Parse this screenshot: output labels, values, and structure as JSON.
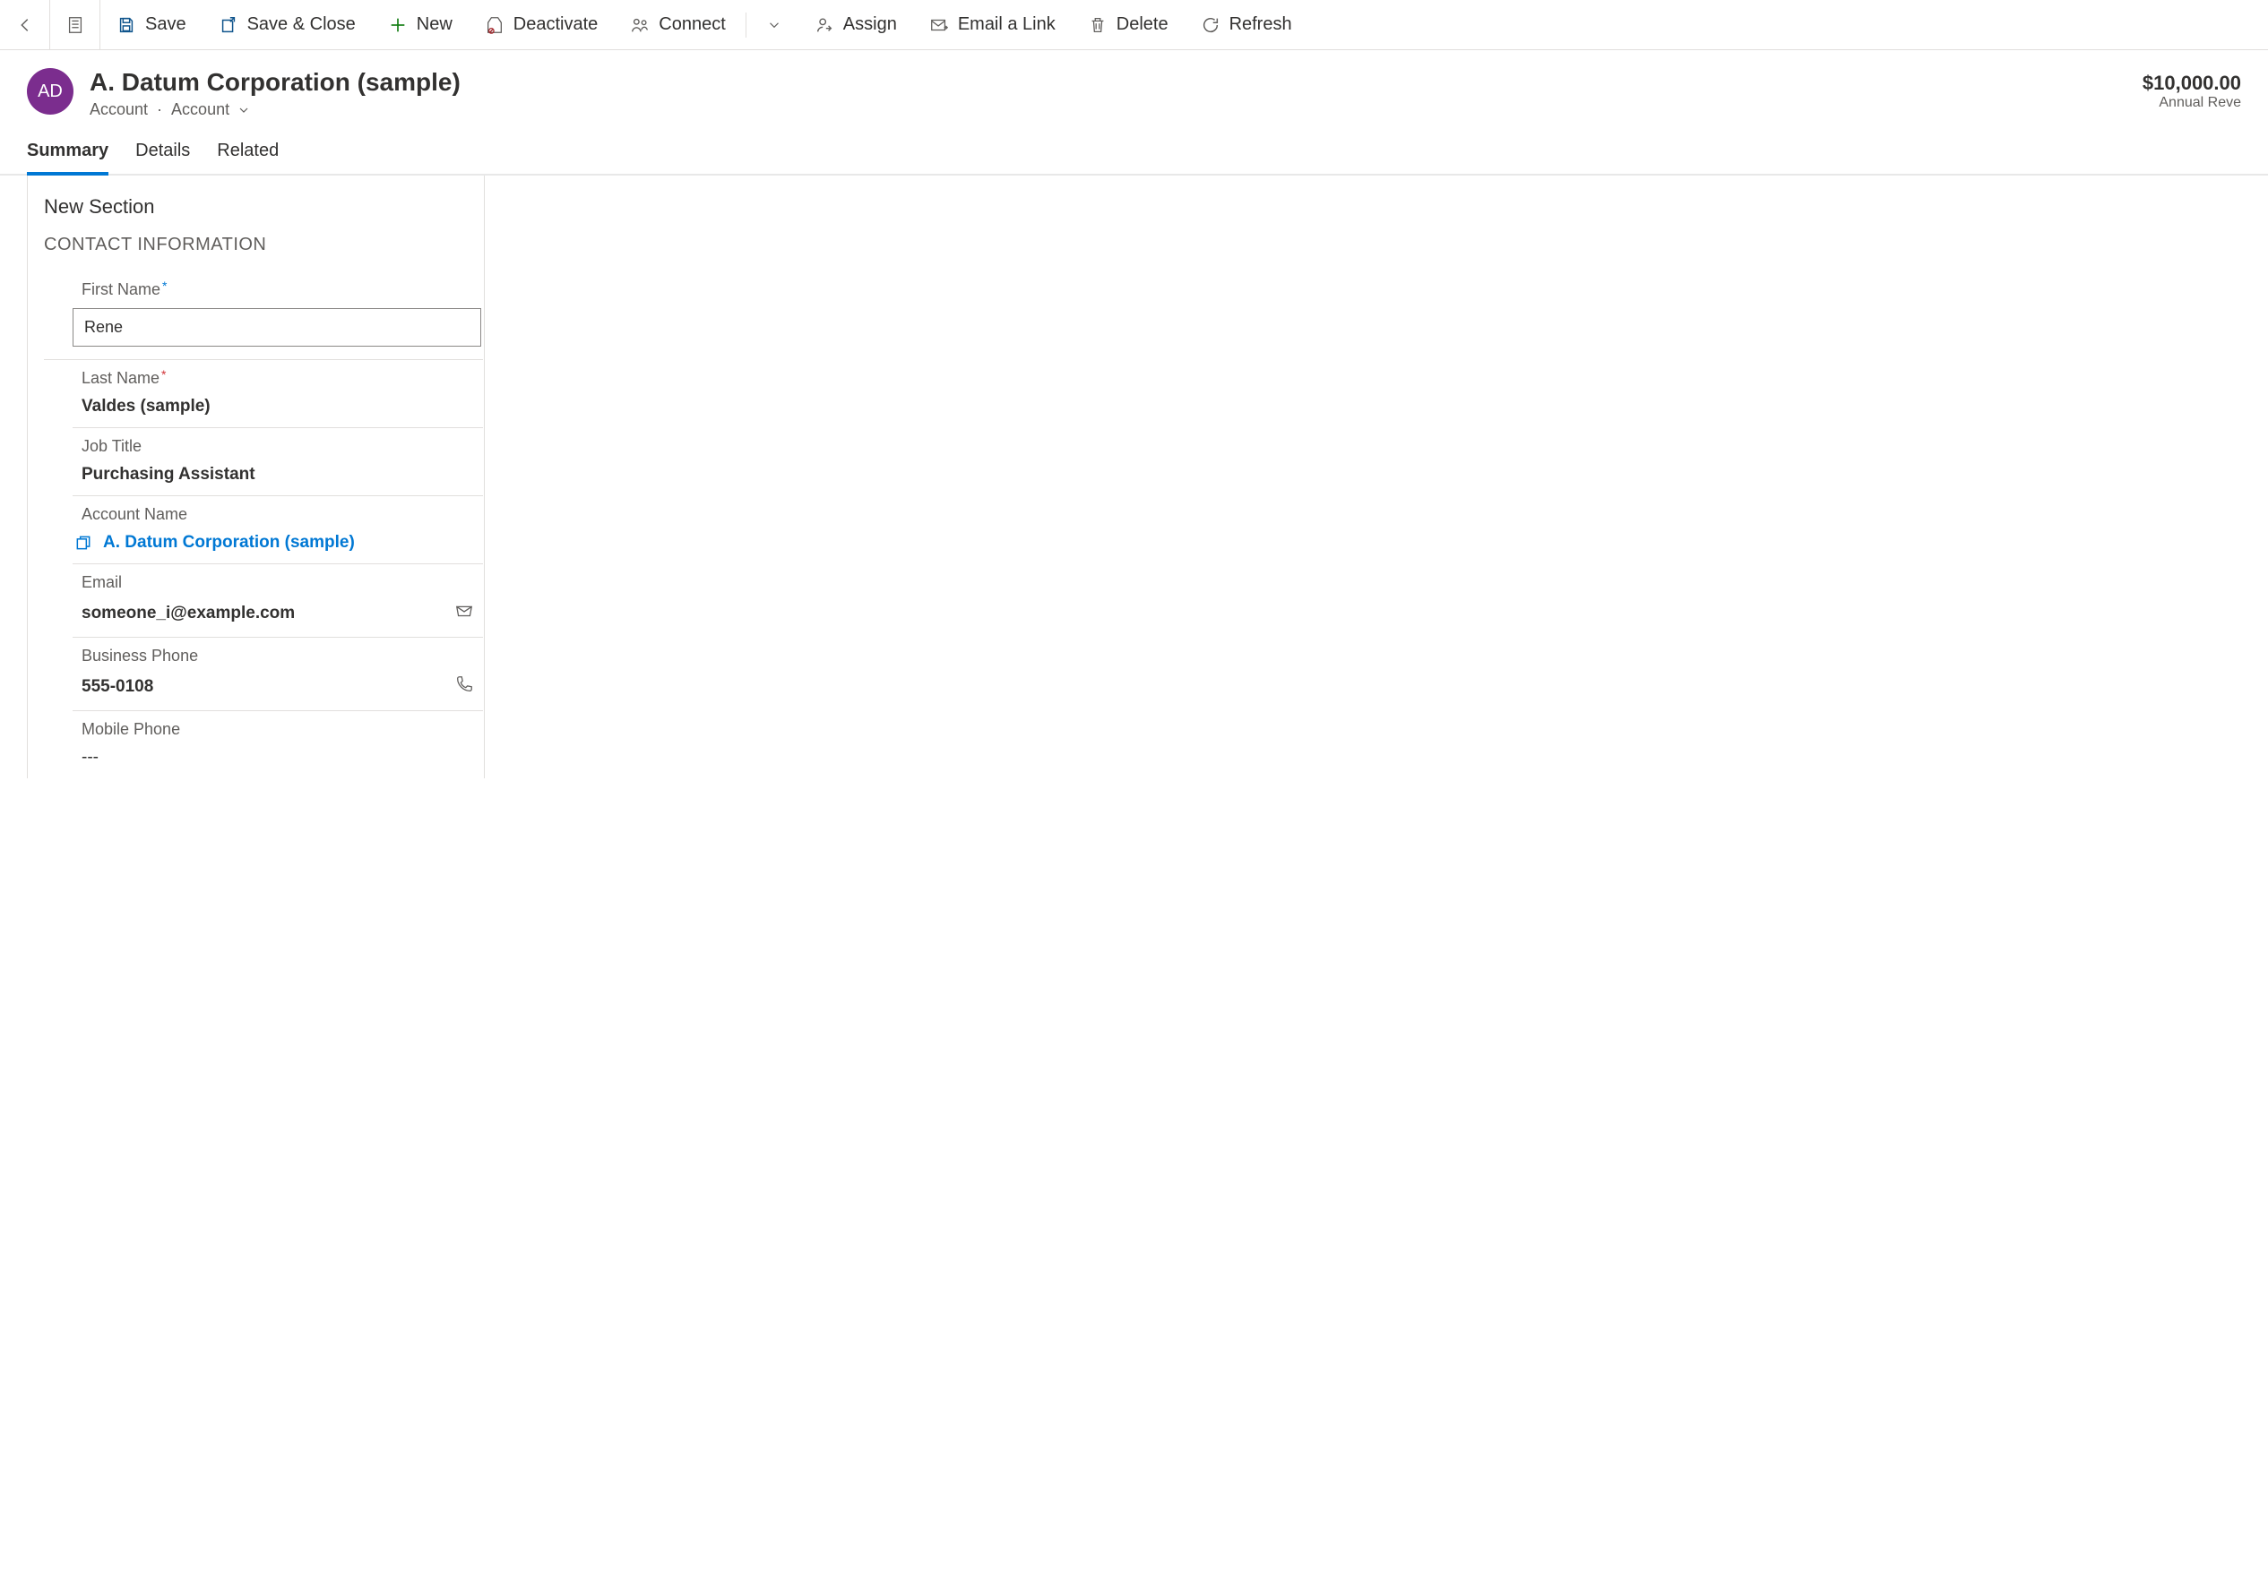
{
  "toolbar": {
    "save": "Save",
    "save_close": "Save & Close",
    "new": "New",
    "deactivate": "Deactivate",
    "connect": "Connect",
    "assign": "Assign",
    "email_link": "Email a Link",
    "delete": "Delete",
    "refresh": "Refresh"
  },
  "header": {
    "avatar": "AD",
    "title": "A. Datum Corporation (sample)",
    "entity": "Account",
    "form": "Account",
    "metric_value": "$10,000.00",
    "metric_label": "Annual Reve"
  },
  "tabs": {
    "summary": "Summary",
    "details": "Details",
    "related": "Related"
  },
  "panel": {
    "section": "New Section",
    "subsection": "CONTACT INFORMATION",
    "first_name_label": "First Name",
    "first_name_value": "Rene",
    "last_name_label": "Last Name",
    "last_name_value": "Valdes (sample)",
    "job_title_label": "Job Title",
    "job_title_value": "Purchasing Assistant",
    "account_name_label": "Account Name",
    "account_name_value": "A. Datum Corporation (sample)",
    "email_label": "Email",
    "email_value": "someone_i@example.com",
    "business_phone_label": "Business Phone",
    "business_phone_value": "555-0108",
    "mobile_phone_label": "Mobile Phone",
    "mobile_phone_value": "---"
  }
}
